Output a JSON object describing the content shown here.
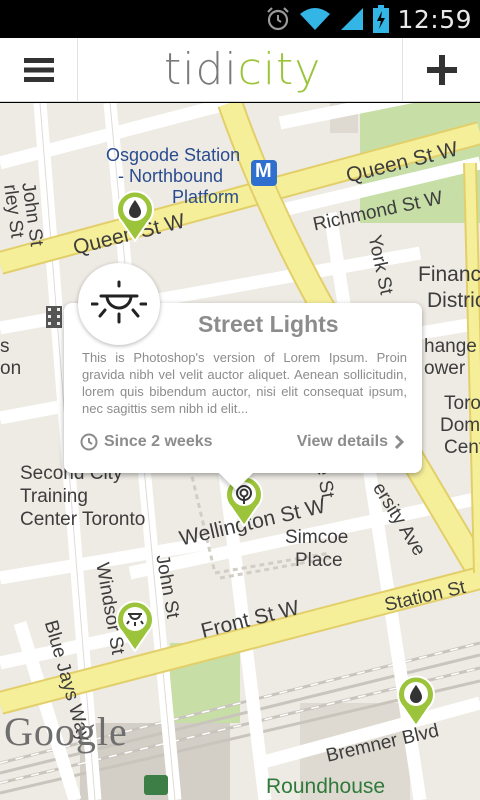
{
  "status_bar": {
    "time": "12:59",
    "icons": [
      "alarm-icon",
      "wifi-icon",
      "cell-signal-icon",
      "battery-charging-icon"
    ]
  },
  "app_bar": {
    "logo_part1": "tidi",
    "logo_part2": "city",
    "menu_icon": "hamburger-menu-icon",
    "add_icon": "plus-icon",
    "colors": {
      "logo_gray": "#7a7a7a",
      "logo_green": "#9bc43a"
    }
  },
  "map": {
    "labels": {
      "osgoode_1": "Osgoode Station",
      "osgoode_2": "- Northbound",
      "osgoode_3": "Platform",
      "metro": "M",
      "queen_st_w_right": "Queen St W",
      "queen_st_w_left": "Queen St W",
      "richmond_st_w": "Richmond St W",
      "john_st_top": "John St",
      "york_st": "York St",
      "financial_1": "Financ",
      "financial_2": "Distric",
      "exchange": "hange",
      "tower": "ower",
      "toronto_dom_1": "Toro",
      "toronto_dom_2": "Domin",
      "toronto_dom_3": "Cent",
      "second_city_1": "Second City",
      "second_city_2": "Training",
      "second_city_3": "Center Toronto",
      "wellington_st_w": "Wellington St W",
      "simcoe_1": "Simcoe",
      "simcoe_2": "Place",
      "university_ave": "ersity Ave",
      "windsor_st": "Windsor St",
      "john_st_bottom": "John St",
      "front_st_w": "Front St W",
      "station_st": "Station St",
      "blue_jays_way": "Blue Jays Way",
      "bremner_blvd": "Bremner Blvd",
      "roundhouse": "Roundhouse",
      "left_s": "s",
      "left_on": "on",
      "left_rley": "rley St",
      "e_st": "e St"
    },
    "google_logo": "Google",
    "colors": {
      "road_yellow": "#f6ef9a",
      "road_yellow_stroke": "#e2cf6a",
      "park": "#c7dfa7",
      "base": "#eeebe4",
      "pin_green": "#9bc43a"
    }
  },
  "popup": {
    "title": "Street Lights",
    "body": "This is Photoshop's version  of Lorem Ipsum. Proin gravida nibh vel velit auctor aliquet. Aenean sollicitudin, lorem quis bibendum auctor, nisi elit consequat ipsum, nec sagittis sem nibh id elit...",
    "since": "Since 2 weeks",
    "details": "View details",
    "icon": "street-light-icon"
  },
  "pins": [
    {
      "name": "water-pin-queen",
      "icon": "water-drop-icon"
    },
    {
      "name": "tree-pin-wellington",
      "icon": "tree-icon"
    },
    {
      "name": "light-pin-windsor",
      "icon": "street-light-icon"
    },
    {
      "name": "water-pin-bremner",
      "icon": "water-drop-icon"
    }
  ]
}
